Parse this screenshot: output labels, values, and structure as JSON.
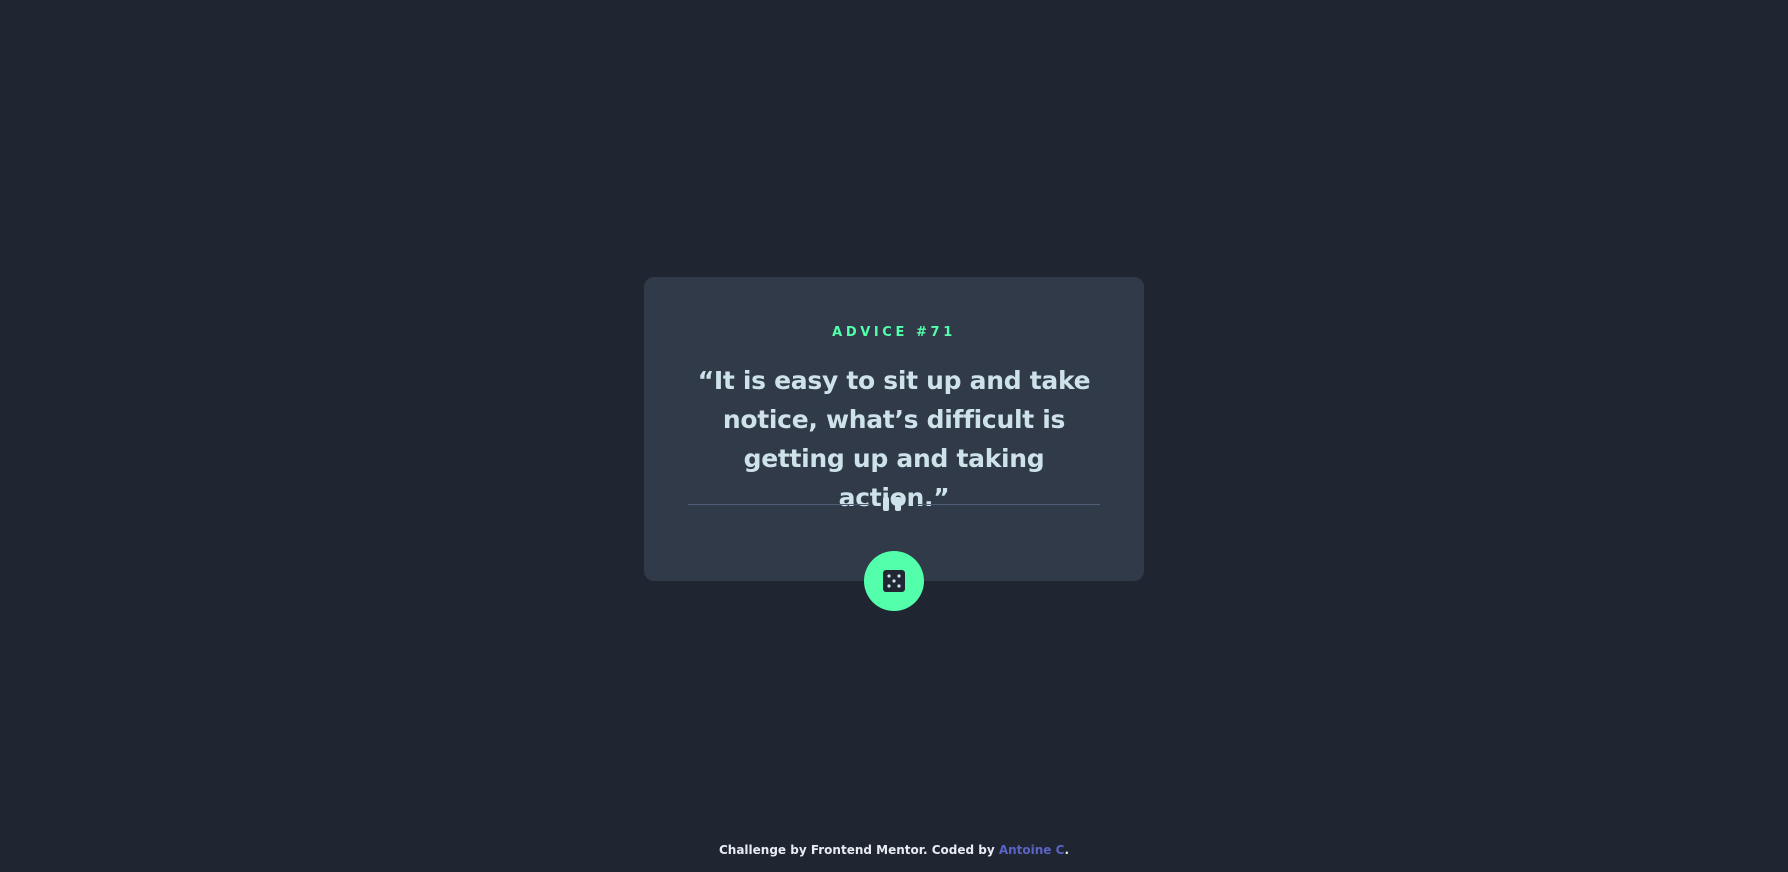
{
  "card": {
    "advice_label": "ADVICE #71",
    "advice_text": "“It is easy to sit up and take notice, what’s difficult is getting up and taking action.”"
  },
  "button": {
    "icon": "dice-icon",
    "aria_label": "Generate new advice"
  },
  "footer": {
    "prefix": "Challenge by Frontend Mentor. Coded by ",
    "author": "Antoine C",
    "suffix": "."
  },
  "colors": {
    "background": "#1f2632",
    "card": "#313a49",
    "accent": "#53ffaa",
    "text": "#cee3e9",
    "link": "#5b63c4"
  }
}
